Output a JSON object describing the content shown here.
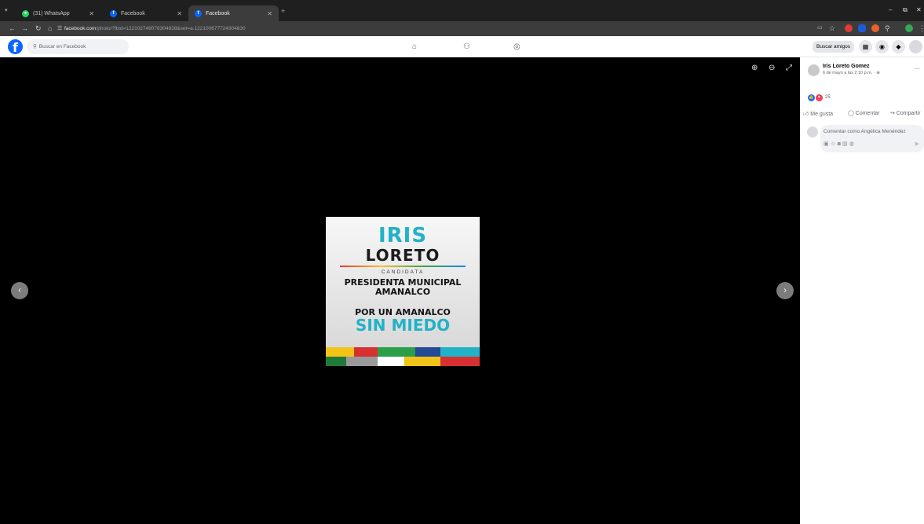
{
  "browser": {
    "tabs": [
      {
        "label": "(31) WhatsApp",
        "icon": "whatsapp-icon",
        "color": "#25d366"
      },
      {
        "label": "Facebook",
        "icon": "facebook-icon",
        "color": "#0866ff"
      },
      {
        "label": "Facebook",
        "icon": "facebook-icon",
        "color": "#0866ff"
      }
    ],
    "url_host": "facebook.com",
    "url_path": "/photo/?fbid=122102749076304838&set=a.122100677724304830"
  },
  "fb": {
    "logo": "f",
    "search_placeholder": "Buscar en Facebook",
    "find_friends": "Buscar amigos"
  },
  "photo": {
    "line1": "IRIS",
    "line2": "LORETO",
    "line3": "CANDIDATA",
    "line4": "PRESIDENTA MUNICIPAL",
    "line5": "AMANALCO",
    "line6": "POR UN AMANALCO",
    "line7": "SIN MIEDO"
  },
  "post": {
    "author": "Iris Loreto Gomez",
    "date": "6 de mayo a las 2:10 p.m. · ",
    "reaction_count": "25",
    "like": "Me gusta",
    "comment": "Comentar",
    "share": "Compartir",
    "comment_placeholder": "Comentar como Angélica Menéndez"
  },
  "colors": {
    "fb_blue": "#0866ff",
    "accent_cyan": "#22b2c7"
  }
}
